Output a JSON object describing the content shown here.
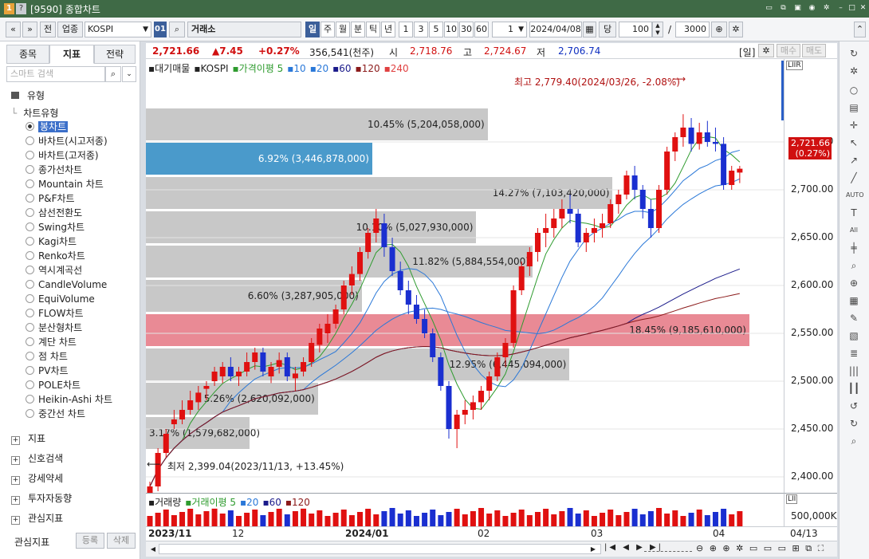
{
  "window": {
    "badge": "1",
    "help": "?",
    "title": "[9590] 종합차트"
  },
  "toolbar": {
    "nav_prev": "«",
    "nav_down": "»",
    "jeon_btn": "전",
    "sector_btn": "업종",
    "symbol": "KOSPI",
    "code_badge": "01",
    "search_icon": "search-icon",
    "market": "거래소",
    "periods": [
      "일",
      "주",
      "월",
      "분",
      "틱",
      "년"
    ],
    "active_period": "일",
    "intervals": [
      "1",
      "3",
      "5",
      "10",
      "30",
      "60"
    ],
    "count": "1",
    "date": "2024/04/08",
    "dang_label": "당",
    "qty": "100",
    "slash": "/",
    "max_qty": "3000",
    "zoom_icon": "magnify-plus-icon",
    "gear_icon": "gear-icon"
  },
  "left": {
    "tabs": [
      "종목",
      "지표",
      "전략"
    ],
    "active_tab": "지표",
    "search_placeholder": "스마트 검색",
    "folder_label": "유형",
    "tree_title": "차트유형",
    "chart_types": [
      "봉차트",
      "바차트(시고저종)",
      "바차트(고저종)",
      "종가선차트",
      "Mountain 차트",
      "P&F차트",
      "삼선전환도",
      "Swing차트",
      "Kagi차트",
      "Renko차트",
      "역시계곡선",
      "CandleVolume",
      "EquiVolume",
      "FLOW차트",
      "분산형차트",
      "계단 차트",
      "점 차트",
      "PV차트",
      "POLE차트",
      "Heikin-Ashi 차트",
      "중간선 차트"
    ],
    "selected_type": "봉차트",
    "groups": [
      "지표",
      "신호검색",
      "강세약세",
      "투자자동향",
      "관심지표"
    ],
    "bottom_label": "관심지표",
    "register_btn": "등록",
    "delete_btn": "삭제"
  },
  "pricebar": {
    "price": "2,721.66",
    "change": "▲7.45",
    "change_pct": "+0.27%",
    "volume": "356,541(천주)",
    "open_label": "시",
    "open": "2,718.76",
    "high_label": "고",
    "high": "2,724.67",
    "low_label": "저",
    "low": "2,706.74",
    "period_badge": "[일]",
    "buy_btn": "매수",
    "sell_btn": "매도"
  },
  "legend": {
    "items": [
      "대기매물",
      "KOSPI",
      "가격이평 5",
      "10",
      "20",
      "60",
      "120",
      "240"
    ],
    "colors": [
      "#222",
      "#222",
      "#2e9b2e",
      "#2a78d8",
      "#2a78d8",
      "#1a1a8a",
      "#8b1a1a",
      "#e04040"
    ]
  },
  "annotations": {
    "high": "최고 2,779.40(2024/03/26, -2.08%)",
    "low": "최저 2,399.04(2023/11/13, +13.45%)"
  },
  "volume_profile": [
    {
      "label": "10.45% (5,204,058,000)",
      "pct": 10.45
    },
    {
      "label": "6.92% (3,446,878,000)",
      "pct": 6.92
    },
    {
      "label": "14.27% (7,103,420,000)",
      "pct": 14.27
    },
    {
      "label": "10.10% (5,027,930,000)",
      "pct": 10.1
    },
    {
      "label": "11.82% (5,884,554,000)",
      "pct": 11.82
    },
    {
      "label": "6.60% (3,287,905,000)",
      "pct": 6.6
    },
    {
      "label": "18.45% (9,185,610,000)",
      "pct": 18.45
    },
    {
      "label": "12.95% (6,445,094,000)",
      "pct": 12.95
    },
    {
      "label": "5.26% (2,620,092,000)",
      "pct": 5.26
    },
    {
      "label": "3.17% (1,579,682,000)",
      "pct": 3.17
    }
  ],
  "y_axis": [
    "2,750.00",
    "2,700.00",
    "2,650.00",
    "2,600.00",
    "2,550.00",
    "2,500.00",
    "2,450.00",
    "2,400.00"
  ],
  "price_tag": [
    "2,721.66",
    "(0.27%)"
  ],
  "volume_legend": [
    "거래량",
    "거래이평 5",
    "20",
    "60",
    "120"
  ],
  "volume_axis": "500,000K",
  "x_axis": [
    "2023/11",
    "12",
    "2024/01",
    "02",
    "03",
    "04"
  ],
  "x_axis_right": "04/13",
  "chart_data": {
    "type": "candlestick",
    "ylim": [
      2390,
      2790
    ],
    "candles": [
      [
        2360,
        2395,
        2350,
        2390
      ],
      [
        2390,
        2430,
        2385,
        2425
      ],
      [
        2425,
        2450,
        2420,
        2445
      ],
      [
        2455,
        2470,
        2450,
        2460
      ],
      [
        2460,
        2480,
        2455,
        2470
      ],
      [
        2470,
        2490,
        2465,
        2480
      ],
      [
        2478,
        2495,
        2470,
        2488
      ],
      [
        2492,
        2500,
        2480,
        2495
      ],
      [
        2500,
        2515,
        2495,
        2510
      ],
      [
        2505,
        2520,
        2498,
        2515
      ],
      [
        2515,
        2525,
        2500,
        2505
      ],
      [
        2505,
        2515,
        2495,
        2510
      ],
      [
        2510,
        2530,
        2505,
        2520
      ],
      [
        2520,
        2535,
        2512,
        2530
      ],
      [
        2530,
        2535,
        2505,
        2510
      ],
      [
        2505,
        2520,
        2498,
        2515
      ],
      [
        2515,
        2530,
        2508,
        2522
      ],
      [
        2525,
        2530,
        2500,
        2505
      ],
      [
        2503,
        2515,
        2490,
        2508
      ],
      [
        2510,
        2525,
        2505,
        2520
      ],
      [
        2520,
        2545,
        2515,
        2540
      ],
      [
        2538,
        2560,
        2530,
        2555
      ],
      [
        2550,
        2570,
        2540,
        2560
      ],
      [
        2560,
        2580,
        2555,
        2575
      ],
      [
        2575,
        2605,
        2570,
        2600
      ],
      [
        2600,
        2620,
        2590,
        2612
      ],
      [
        2612,
        2640,
        2605,
        2635
      ],
      [
        2635,
        2660,
        2628,
        2655
      ],
      [
        2655,
        2680,
        2645,
        2670
      ],
      [
        2665,
        2675,
        2630,
        2640
      ],
      [
        2640,
        2650,
        2610,
        2615
      ],
      [
        2615,
        2625,
        2590,
        2595
      ],
      [
        2595,
        2605,
        2570,
        2580
      ],
      [
        2580,
        2590,
        2560,
        2565
      ],
      [
        2565,
        2575,
        2545,
        2550
      ],
      [
        2550,
        2555,
        2520,
        2525
      ],
      [
        2525,
        2530,
        2490,
        2495
      ],
      [
        2495,
        2500,
        2440,
        2450
      ],
      [
        2450,
        2470,
        2430,
        2465
      ],
      [
        2465,
        2480,
        2455,
        2470
      ],
      [
        2470,
        2485,
        2460,
        2478
      ],
      [
        2478,
        2495,
        2470,
        2490
      ],
      [
        2490,
        2510,
        2480,
        2505
      ],
      [
        2505,
        2530,
        2500,
        2525
      ],
      [
        2525,
        2545,
        2515,
        2540
      ],
      [
        2540,
        2600,
        2535,
        2595
      ],
      [
        2595,
        2625,
        2590,
        2620
      ],
      [
        2620,
        2640,
        2610,
        2635
      ],
      [
        2635,
        2660,
        2625,
        2655
      ],
      [
        2655,
        2675,
        2640,
        2660
      ],
      [
        2660,
        2680,
        2650,
        2670
      ],
      [
        2670,
        2690,
        2660,
        2680
      ],
      [
        2680,
        2695,
        2665,
        2675
      ],
      [
        2675,
        2680,
        2640,
        2645
      ],
      [
        2645,
        2660,
        2635,
        2655
      ],
      [
        2655,
        2670,
        2645,
        2660
      ],
      [
        2660,
        2675,
        2650,
        2665
      ],
      [
        2665,
        2690,
        2660,
        2685
      ],
      [
        2685,
        2700,
        2675,
        2695
      ],
      [
        2695,
        2720,
        2690,
        2715
      ],
      [
        2715,
        2725,
        2690,
        2700
      ],
      [
        2700,
        2705,
        2670,
        2680
      ],
      [
        2680,
        2690,
        2650,
        2660
      ],
      [
        2660,
        2705,
        2655,
        2700
      ],
      [
        2700,
        2745,
        2695,
        2740
      ],
      [
        2740,
        2760,
        2730,
        2755
      ],
      [
        2755,
        2779,
        2745,
        2765
      ],
      [
        2765,
        2775,
        2740,
        2748
      ],
      [
        2748,
        2770,
        2742,
        2760
      ],
      [
        2760,
        2772,
        2745,
        2750
      ],
      [
        2750,
        2765,
        2740,
        2748
      ],
      [
        2748,
        2755,
        2700,
        2705
      ],
      [
        2705,
        2725,
        2700,
        2720
      ],
      [
        2718,
        2725,
        2707,
        2722
      ]
    ]
  }
}
